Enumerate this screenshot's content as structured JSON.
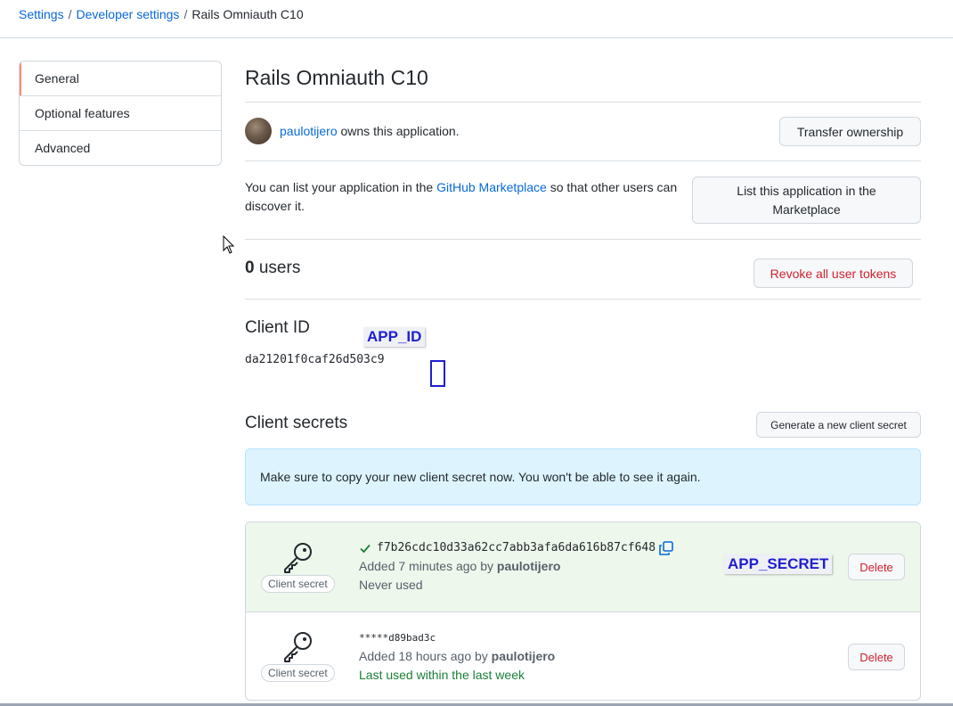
{
  "breadcrumb": {
    "settings": "Settings",
    "separator": "/",
    "developer_settings": "Developer settings",
    "current": "Rails Omniauth C10"
  },
  "sidebar": {
    "items": [
      {
        "label": "General",
        "selected": true
      },
      {
        "label": "Optional features",
        "selected": false
      },
      {
        "label": "Advanced",
        "selected": false
      }
    ]
  },
  "app": {
    "title": "Rails Omniauth C10",
    "owner": "paulotijero",
    "owner_suffix": "owns this application.",
    "transfer_button": "Transfer ownership"
  },
  "marketplace": {
    "text_before": "You can list your application in the",
    "link": "GitHub Marketplace",
    "text_after": "so that other users can discover it.",
    "button": "List this application in the Marketplace"
  },
  "users": {
    "count": "0",
    "label": "users",
    "revoke_button": "Revoke all user tokens"
  },
  "client_id": {
    "heading": "Client ID",
    "value": "da21201f0caf26d503c9",
    "annotation": "APP_ID"
  },
  "client_secrets": {
    "heading": "Client secrets",
    "generate_button": "Generate a new client secret",
    "flash": "Make sure to copy your new client secret now. You won't be able to see it again.",
    "annotation": "APP_SECRET",
    "items": [
      {
        "label": "Client secret",
        "secret": "f7b26cdc10d33a62cc7abb3afa6da616b87cf648",
        "added_prefix": "Added 7 minutes ago by",
        "added_by": "paulotijero",
        "usage": "Never used",
        "delete": "Delete"
      },
      {
        "label": "Client secret",
        "secret": "*****d89bad3c",
        "added_prefix": "Added 18 hours ago by",
        "added_by": "paulotijero",
        "usage": "Last used within the last week",
        "delete": "Delete"
      }
    ]
  },
  "icons": {
    "key": "key-icon",
    "check": "check-icon",
    "copy": "copy-icon",
    "cursor": "mouse-cursor-icon"
  },
  "colors": {
    "link": "#0969da",
    "danger": "#cf222e",
    "success": "#1a7f37",
    "selected_marker": "#fd8c73",
    "flash_bg": "#ddf4ff",
    "new_secret_bg": "#eef7ec",
    "annotation": "#1f1fd0"
  }
}
